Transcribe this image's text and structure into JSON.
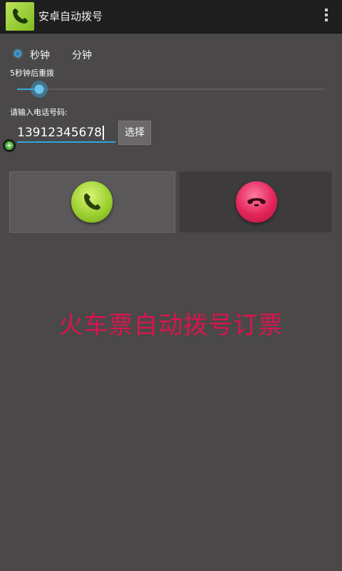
{
  "app": {
    "title": "安卓自动拨号"
  },
  "icons": {
    "app": "phone-icon",
    "overflow": "overflow-menu-icon",
    "add": "plus-icon",
    "call": "phone-call-icon",
    "hangup": "phone-hangup-icon"
  },
  "unit": {
    "options": [
      "秒钟",
      "分钟"
    ],
    "selected": "秒钟"
  },
  "redial": {
    "label": "5秒钟后重拨",
    "slider_fraction": 0.05
  },
  "phone": {
    "label": "请输入电话号码:",
    "value": "13912345678",
    "select_label": "选择"
  },
  "banner": {
    "text": "火车票自动拨号订票"
  },
  "colors": {
    "accent": "#33a6dc",
    "call_green": "#9cd12f",
    "hangup_red": "#e3245a",
    "banner_text": "#d8154f",
    "background": "#4a4848"
  }
}
